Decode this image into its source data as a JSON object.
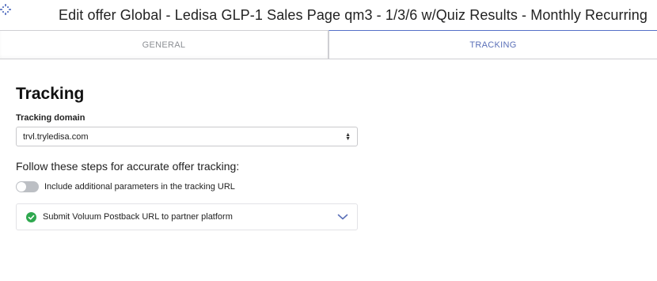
{
  "header": {
    "title": "Edit offer Global - Ledisa GLP-1 Sales Page qm3 - 1/3/6 w/Quiz Results - Monthly Recurring"
  },
  "tabs": [
    {
      "label": "GENERAL",
      "active": false
    },
    {
      "label": "TRACKING",
      "active": true
    }
  ],
  "tracking": {
    "section_title": "Tracking",
    "domain_label": "Tracking domain",
    "domain_value": "trvl.tryledisa.com",
    "steps_title": "Follow these steps for accurate offer tracking:",
    "toggle_label": "Include additional parameters in the tracking URL",
    "toggle_on": false,
    "step_label": "Submit Voluum Postback URL to partner platform",
    "step_complete": true
  },
  "icons": {
    "drag": "drag-handle-icon",
    "check": "check-circle-icon",
    "chevron": "chevron-down-icon"
  },
  "colors": {
    "accent": "#5b70b8",
    "success": "#2fa84f",
    "toggle_off": "#bcbfc4"
  }
}
